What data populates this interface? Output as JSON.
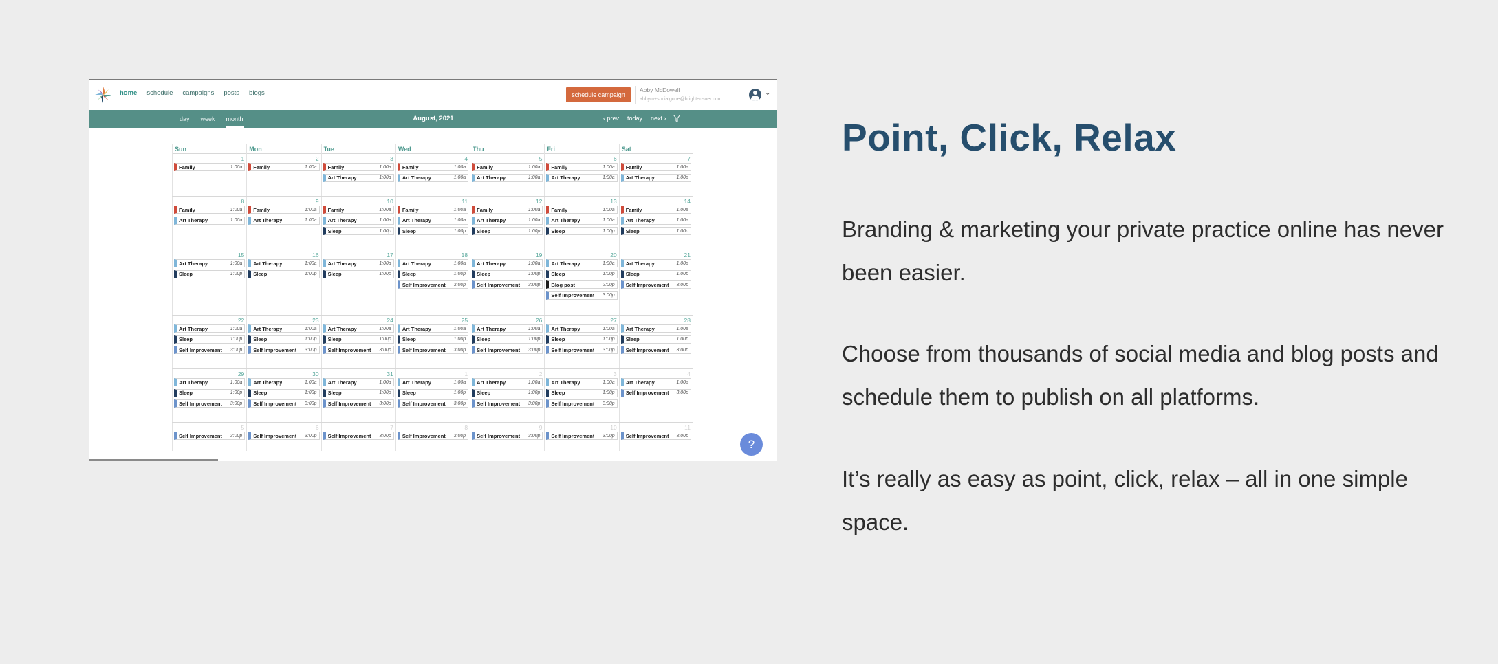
{
  "nav": {
    "links": [
      "home",
      "schedule",
      "campaigns",
      "posts",
      "blogs"
    ],
    "active": "home",
    "cta": "schedule campaign"
  },
  "user": {
    "name": "Abby McDowell",
    "email": "abbym+socialgone@brightensoer.com"
  },
  "calendar": {
    "views": [
      "day",
      "week",
      "month"
    ],
    "active_view": "month",
    "title": "August, 2021",
    "prev": "‹ prev",
    "today": "today",
    "next": "next ›",
    "day_headers": [
      "Sun",
      "Mon",
      "Tue",
      "Wed",
      "Thu",
      "Fri",
      "Sat"
    ],
    "weeks": [
      {
        "days": [
          {
            "n": "1",
            "ev": [
              [
                "family",
                "Family",
                "1:00a"
              ]
            ]
          },
          {
            "n": "2",
            "ev": [
              [
                "family",
                "Family",
                "1:00a"
              ]
            ]
          },
          {
            "n": "3",
            "ev": [
              [
                "family",
                "Family",
                "1:00a"
              ],
              [
                "art",
                "Art Therapy",
                "1:00a"
              ]
            ]
          },
          {
            "n": "4",
            "ev": [
              [
                "family",
                "Family",
                "1:00a"
              ],
              [
                "art",
                "Art Therapy",
                "1:00a"
              ]
            ]
          },
          {
            "n": "5",
            "ev": [
              [
                "family",
                "Family",
                "1:00a"
              ],
              [
                "art",
                "Art Therapy",
                "1:00a"
              ]
            ]
          },
          {
            "n": "6",
            "ev": [
              [
                "family",
                "Family",
                "1:00a"
              ],
              [
                "art",
                "Art Therapy",
                "1:00a"
              ]
            ]
          },
          {
            "n": "7",
            "ev": [
              [
                "family",
                "Family",
                "1:00a"
              ],
              [
                "art",
                "Art Therapy",
                "1:00a"
              ]
            ]
          }
        ]
      },
      {
        "days": [
          {
            "n": "8",
            "ev": [
              [
                "family",
                "Family",
                "1:00a"
              ],
              [
                "art",
                "Art Therapy",
                "1:00a"
              ]
            ]
          },
          {
            "n": "9",
            "ev": [
              [
                "family",
                "Family",
                "1:00a"
              ],
              [
                "art",
                "Art Therapy",
                "1:00a"
              ]
            ]
          },
          {
            "n": "10",
            "ev": [
              [
                "family",
                "Family",
                "1:00a"
              ],
              [
                "art",
                "Art Therapy",
                "1:00a"
              ],
              [
                "sleep",
                "Sleep",
                "1:00p"
              ]
            ]
          },
          {
            "n": "11",
            "ev": [
              [
                "family",
                "Family",
                "1:00a"
              ],
              [
                "art",
                "Art Therapy",
                "1:00a"
              ],
              [
                "sleep",
                "Sleep",
                "1:00p"
              ]
            ]
          },
          {
            "n": "12",
            "ev": [
              [
                "family",
                "Family",
                "1:00a"
              ],
              [
                "art",
                "Art Therapy",
                "1:00a"
              ],
              [
                "sleep",
                "Sleep",
                "1:00p"
              ]
            ]
          },
          {
            "n": "13",
            "ev": [
              [
                "family",
                "Family",
                "1:00a"
              ],
              [
                "art",
                "Art Therapy",
                "1:00a"
              ],
              [
                "sleep",
                "Sleep",
                "1:00p"
              ]
            ]
          },
          {
            "n": "14",
            "ev": [
              [
                "family",
                "Family",
                "1:00a"
              ],
              [
                "art",
                "Art Therapy",
                "1:00a"
              ],
              [
                "sleep",
                "Sleep",
                "1:00p"
              ]
            ]
          }
        ]
      },
      {
        "days": [
          {
            "n": "15",
            "ev": [
              [
                "art",
                "Art Therapy",
                "1:00a"
              ],
              [
                "sleep",
                "Sleep",
                "1:00p"
              ]
            ]
          },
          {
            "n": "16",
            "ev": [
              [
                "art",
                "Art Therapy",
                "1:00a"
              ],
              [
                "sleep",
                "Sleep",
                "1:00p"
              ]
            ]
          },
          {
            "n": "17",
            "ev": [
              [
                "art",
                "Art Therapy",
                "1:00a"
              ],
              [
                "sleep",
                "Sleep",
                "1:00p"
              ]
            ]
          },
          {
            "n": "18",
            "ev": [
              [
                "art",
                "Art Therapy",
                "1:00a"
              ],
              [
                "sleep",
                "Sleep",
                "1:00p"
              ],
              [
                "self",
                "Self Improvement",
                "3:00p"
              ]
            ]
          },
          {
            "n": "19",
            "ev": [
              [
                "art",
                "Art Therapy",
                "1:00a"
              ],
              [
                "sleep",
                "Sleep",
                "1:00p"
              ],
              [
                "self",
                "Self Improvement",
                "3:00p"
              ]
            ]
          },
          {
            "n": "20",
            "ev": [
              [
                "art",
                "Art Therapy",
                "1:00a"
              ],
              [
                "sleep",
                "Sleep",
                "1:00p"
              ],
              [
                "blog",
                "Blog post",
                "2:00p"
              ],
              [
                "self",
                "Self Improvement",
                "3:00p"
              ]
            ]
          },
          {
            "n": "21",
            "ev": [
              [
                "art",
                "Art Therapy",
                "1:00a"
              ],
              [
                "sleep",
                "Sleep",
                "1:00p"
              ],
              [
                "self",
                "Self Improvement",
                "3:00p"
              ]
            ]
          }
        ]
      },
      {
        "days": [
          {
            "n": "22",
            "ev": [
              [
                "art",
                "Art Therapy",
                "1:00a"
              ],
              [
                "sleep",
                "Sleep",
                "1:00p"
              ],
              [
                "self",
                "Self Improvement",
                "3:00p"
              ]
            ]
          },
          {
            "n": "23",
            "ev": [
              [
                "art",
                "Art Therapy",
                "1:00a"
              ],
              [
                "sleep",
                "Sleep",
                "1:00p"
              ],
              [
                "self",
                "Self Improvement",
                "3:00p"
              ]
            ]
          },
          {
            "n": "24",
            "ev": [
              [
                "art",
                "Art Therapy",
                "1:00a"
              ],
              [
                "sleep",
                "Sleep",
                "1:00p"
              ],
              [
                "self",
                "Self Improvement",
                "3:00p"
              ]
            ]
          },
          {
            "n": "25",
            "ev": [
              [
                "art",
                "Art Therapy",
                "1:00a"
              ],
              [
                "sleep",
                "Sleep",
                "1:00p"
              ],
              [
                "self",
                "Self Improvement",
                "3:00p"
              ]
            ]
          },
          {
            "n": "26",
            "ev": [
              [
                "art",
                "Art Therapy",
                "1:00a"
              ],
              [
                "sleep",
                "Sleep",
                "1:00p"
              ],
              [
                "self",
                "Self Improvement",
                "3:00p"
              ]
            ]
          },
          {
            "n": "27",
            "ev": [
              [
                "art",
                "Art Therapy",
                "1:00a"
              ],
              [
                "sleep",
                "Sleep",
                "1:00p"
              ],
              [
                "self",
                "Self Improvement",
                "3:00p"
              ]
            ]
          },
          {
            "n": "28",
            "ev": [
              [
                "art",
                "Art Therapy",
                "1:00a"
              ],
              [
                "sleep",
                "Sleep",
                "1:00p"
              ],
              [
                "self",
                "Self Improvement",
                "3:00p"
              ]
            ]
          }
        ]
      },
      {
        "days": [
          {
            "n": "29",
            "ev": [
              [
                "art",
                "Art Therapy",
                "1:00a"
              ],
              [
                "sleep",
                "Sleep",
                "1:00p"
              ],
              [
                "self",
                "Self Improvement",
                "3:00p"
              ]
            ]
          },
          {
            "n": "30",
            "ev": [
              [
                "art",
                "Art Therapy",
                "1:00a"
              ],
              [
                "sleep",
                "Sleep",
                "1:00p"
              ],
              [
                "self",
                "Self Improvement",
                "3:00p"
              ]
            ]
          },
          {
            "n": "31",
            "ev": [
              [
                "art",
                "Art Therapy",
                "1:00a"
              ],
              [
                "sleep",
                "Sleep",
                "1:00p"
              ],
              [
                "self",
                "Self Improvement",
                "3:00p"
              ]
            ]
          },
          {
            "n": "1",
            "other": true,
            "ev": [
              [
                "art",
                "Art Therapy",
                "1:00a"
              ],
              [
                "sleep",
                "Sleep",
                "1:00p"
              ],
              [
                "self",
                "Self Improvement",
                "3:00p"
              ]
            ]
          },
          {
            "n": "2",
            "other": true,
            "ev": [
              [
                "art",
                "Art Therapy",
                "1:00a"
              ],
              [
                "sleep",
                "Sleep",
                "1:00p"
              ],
              [
                "self",
                "Self Improvement",
                "3:00p"
              ]
            ]
          },
          {
            "n": "3",
            "other": true,
            "ev": [
              [
                "art",
                "Art Therapy",
                "1:00a"
              ],
              [
                "sleep",
                "Sleep",
                "1:00p"
              ],
              [
                "self",
                "Self Improvement",
                "3:00p"
              ]
            ]
          },
          {
            "n": "4",
            "other": true,
            "ev": [
              [
                "art",
                "Art Therapy",
                "1:00a"
              ],
              [
                "self",
                "Self Improvement",
                "3:00p"
              ]
            ]
          }
        ]
      },
      {
        "days": [
          {
            "n": "5",
            "other": true,
            "ev": [
              [
                "self",
                "Self Improvement",
                "3:00p"
              ]
            ]
          },
          {
            "n": "6",
            "other": true,
            "ev": [
              [
                "self",
                "Self Improvement",
                "3:00p"
              ]
            ]
          },
          {
            "n": "7",
            "other": true,
            "ev": [
              [
                "self",
                "Self Improvement",
                "3:00p"
              ]
            ]
          },
          {
            "n": "8",
            "other": true,
            "ev": [
              [
                "self",
                "Self Improvement",
                "3:00p"
              ]
            ]
          },
          {
            "n": "9",
            "other": true,
            "ev": [
              [
                "self",
                "Self Improvement",
                "3:00p"
              ]
            ]
          },
          {
            "n": "10",
            "other": true,
            "ev": [
              [
                "self",
                "Self Improvement",
                "3:00p"
              ]
            ]
          },
          {
            "n": "11",
            "other": true,
            "ev": [
              [
                "self",
                "Self Improvement",
                "3:00p"
              ]
            ]
          }
        ]
      }
    ]
  },
  "help": "?",
  "headline": "Point, Click, Relax",
  "paragraphs": [
    "Branding & marketing your private practice online has never been easier.",
    "Choose from thousands of social media and blog posts and schedule them to publish on all platforms.",
    "It’s really as easy as point, click, relax – all in one simple space."
  ],
  "colors": {
    "teal_bar": "#558f87",
    "cta": "#d4693d",
    "headline": "#264e6d",
    "family": "#cf4b3b",
    "art": "#7fb6d9",
    "sleep": "#213c5e",
    "self": "#6c93cb",
    "help": "#6a8bdb"
  }
}
